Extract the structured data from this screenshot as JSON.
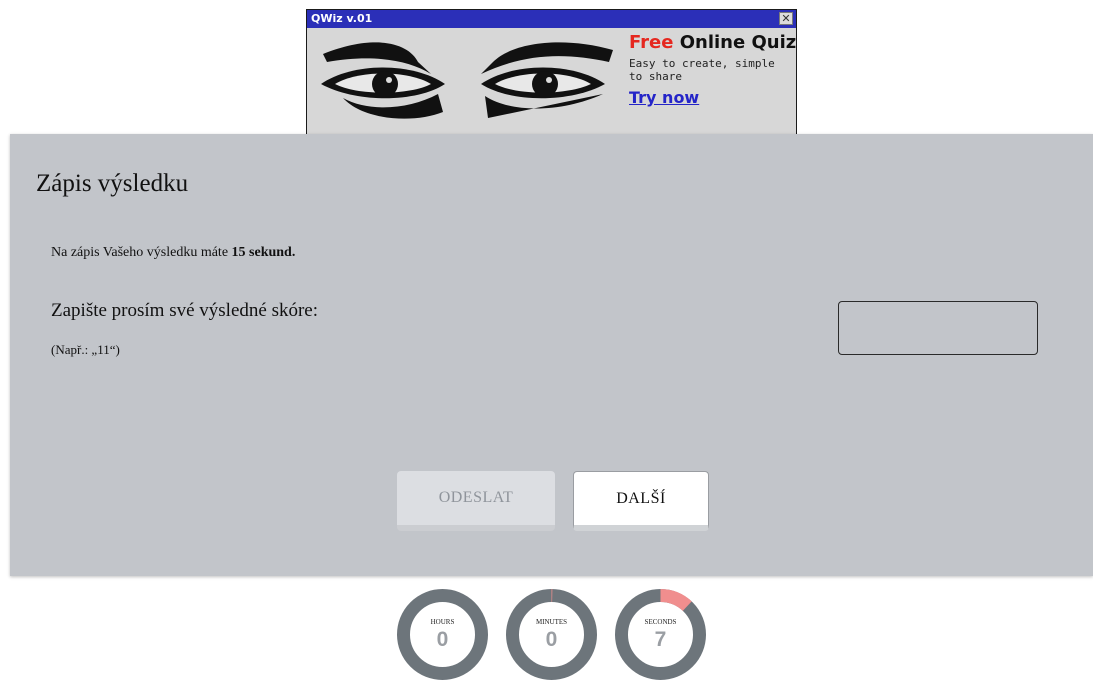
{
  "ad": {
    "title": "QWiz v.01",
    "close_glyph": "✕",
    "headline_free": "Free",
    "headline_rest": " Online Quiz",
    "subline": "Easy to create, simple to share",
    "cta": "Try now",
    "colors": {
      "titlebar": "#2b2fb8",
      "free": "#e5271f",
      "cta": "#2424c8"
    }
  },
  "panel": {
    "title": "Zápis výsledku",
    "instruction_prefix": "Na zápis Vašeho výsledku máte ",
    "instruction_bold": "15 sekund.",
    "question": "Zapište prosím své výsledné skóre:",
    "hint": "(Např.: „11“)",
    "score_value": "",
    "buttons": {
      "send": "ODESLAT",
      "next": "DALŠÍ"
    }
  },
  "timers": {
    "hours": {
      "label": "HOURS",
      "value": "0",
      "progress": 0
    },
    "minutes": {
      "label": "MINUTES",
      "value": "0",
      "progress": 0.003
    },
    "seconds": {
      "label": "SECONDS",
      "value": "7",
      "progress": 0.12
    },
    "colors": {
      "track": "#6d757b",
      "progress": "#f08e8e",
      "value": "#9a9ea3"
    }
  }
}
